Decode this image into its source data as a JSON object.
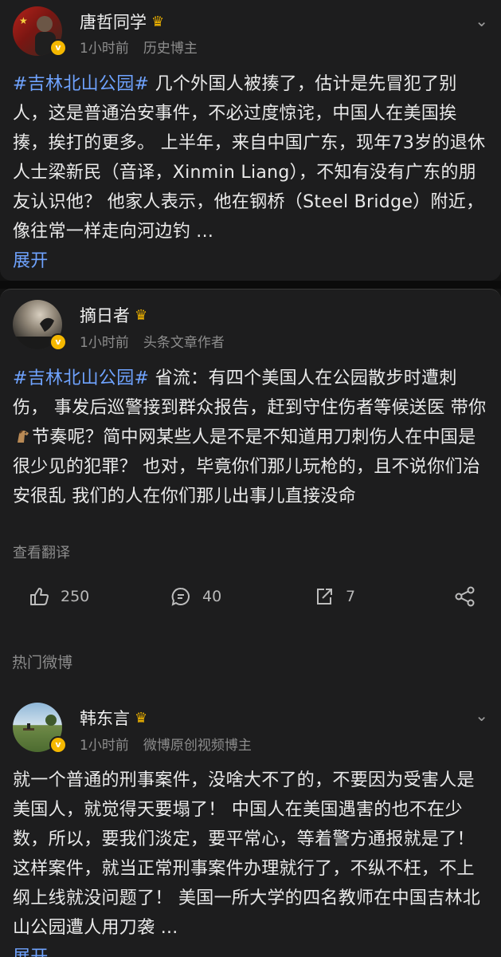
{
  "posts": [
    {
      "author": "唐哲同学",
      "time": "1小时前",
      "role": "历史博主",
      "hashtag": "#吉林北山公园#",
      "text": " 几个外国人被揍了，估计是先冒犯了别人，这是普通治安事件，不必过度惊诧，中国人在美国挨揍，挨打的更多。 上半年，来自中国广东，现年73岁的退休人士梁新民（音译，Xinmin Liang），不知有没有广东的朋友认识他？ 他家人表示，他在钢桥（Steel Bridge）附近，像往常一样走向河边钓 ...",
      "expand": "展开"
    },
    {
      "author": "摘日者",
      "time": "1小时前",
      "role": "头条文章作者",
      "hashtag": "#吉林北山公园#",
      "text_before": " 省流：有四个美国人在公园散步时遭刺伤， 事发后巡警接到群众报告，赶到守住伤者等候送医 带你",
      "text_after": "节奏呢？简中网某些人是不是不知道用刀刺伤人在中国是很少见的犯罪？ 也对，毕竟你们那儿玩枪的，且不说你们治安很乱 我们的人在你们那儿出事儿直接没命",
      "translate": "查看翻译",
      "likes": "250",
      "comments": "40",
      "reposts": "7"
    },
    {
      "author": "韩东言",
      "time": "1小时前",
      "role": "微博原创视频博主",
      "text": "就一个普通的刑事案件，没啥大不了的，不要因为受害人是美国人，就觉得天要塌了！ 中国人在美国遇害的也不在少数，所以，要我们淡定，要平常心，等着警方通报就是了！ 这样案件，就当正常刑事案件办理就行了，不纵不枉，不上纲上线就没问题了！ 美国一所大学的四名教师在中国吉林北山公园遭人用刀袭 ...",
      "expand": "展开"
    }
  ],
  "section_label": "热门微博",
  "icons": {
    "verified": "verified-badge-icon",
    "crown": "crown-icon",
    "more": "chevron-down-icon",
    "like": "thumbs-up-icon",
    "comment": "comment-icon",
    "repost": "repost-icon",
    "share": "share-icon",
    "emoji": "horse-emoji-icon"
  },
  "colors": {
    "background": "#121212",
    "card": "#1d1d1e",
    "link": "#6fa3ff",
    "muted": "#8c8c8c",
    "verified": "#f5b800"
  }
}
